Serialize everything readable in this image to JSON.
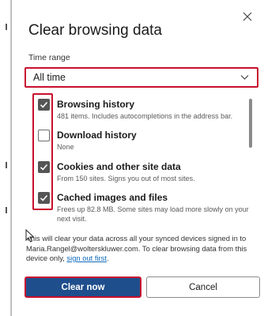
{
  "dialog": {
    "title": "Clear browsing data",
    "time_range_label": "Time range",
    "time_range_value": "All time"
  },
  "items": [
    {
      "title": "Browsing history",
      "desc": "481 items. Includes autocompletions in the address bar.",
      "checked": true
    },
    {
      "title": "Download history",
      "desc": "None",
      "checked": false
    },
    {
      "title": "Cookies and other site data",
      "desc": "From 150 sites. Signs you out of most sites.",
      "checked": true
    },
    {
      "title": "Cached images and files",
      "desc": "Frees up 82.8 MB. Some sites may load more slowly on your next visit.",
      "checked": true
    }
  ],
  "info": {
    "text": "This will clear your data across all your synced devices signed in to Maria.Rangel@wolterskluwer.com. To clear browsing data from this device only, ",
    "link": "sign out first",
    "end": "."
  },
  "buttons": {
    "clear": "Clear now",
    "cancel": "Cancel"
  },
  "colors": {
    "accent": "#1f4e8c",
    "highlight": "#c8102e",
    "checkbox": "#555555",
    "link": "#0f6cbd"
  },
  "icons": {
    "close": "close-icon",
    "chevron": "chevron-down-icon",
    "check": "checkmark-icon",
    "cursor": "mouse-pointer-icon"
  }
}
